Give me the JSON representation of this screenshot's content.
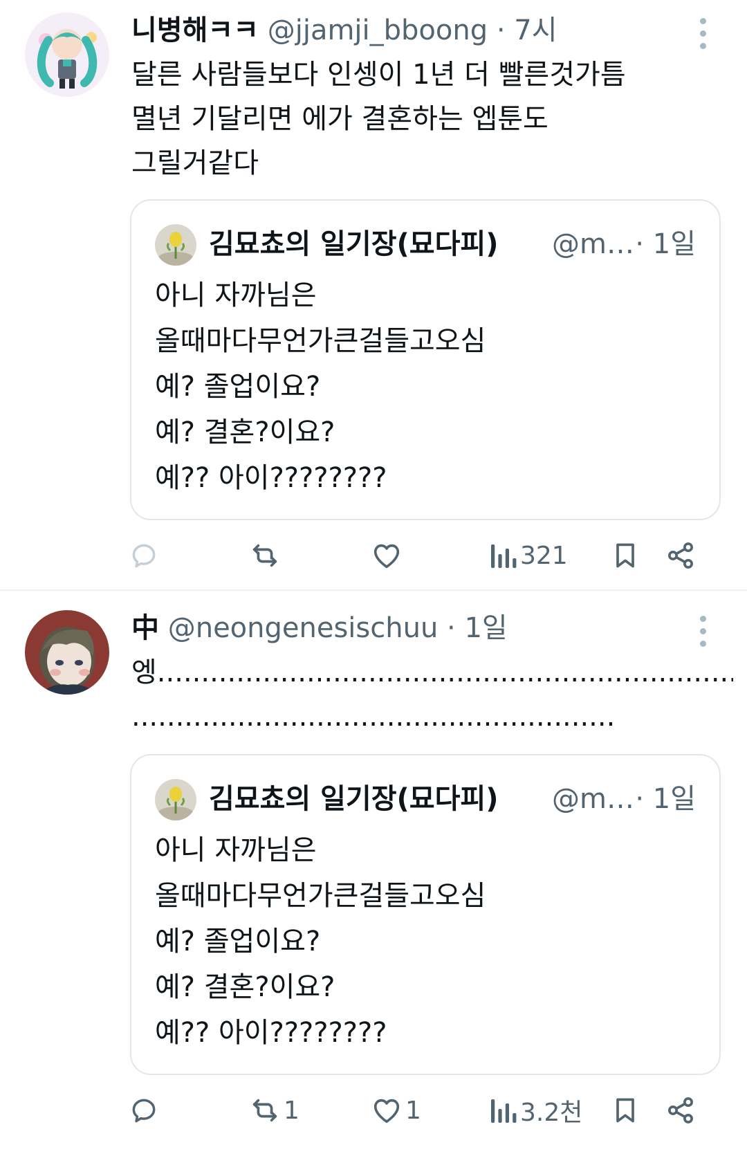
{
  "tweets": [
    {
      "display_name": "니병해ㅋㅋ",
      "handle": "@jjamji_bboong",
      "time": "7시",
      "text": "달른 사람들보다 인셍이 1년 더 빨른것가틈\n멸년 기달리면 에가 결혼하는 엡툰도\n그릴거같다",
      "quote": {
        "display_name": "김묘쵸의 일기장(묘다피)",
        "handle": "@m…",
        "time": "1일",
        "text": "아니 자까님은\n올때마다무언가큰걸들고오심\n예? 졸업이요?\n예? 결혼?이요?\n예?? 아이????????"
      },
      "stats": {
        "replies": "",
        "retweets": "",
        "likes": "",
        "views": "321"
      }
    },
    {
      "display_name": "中",
      "handle": "@neongenesischuu",
      "time": "1일",
      "text": "엥.....................................................................\n.......................................................",
      "quote": {
        "display_name": "김묘쵸의 일기장(묘다피)",
        "handle": "@m…",
        "time": "1일",
        "text": "아니 자까님은\n올때마다무언가큰걸들고오심\n예? 졸업이요?\n예? 결혼?이요?\n예?? 아이????????"
      },
      "stats": {
        "replies": "",
        "retweets": "1",
        "likes": "1",
        "views": "3.2천"
      }
    }
  ],
  "ui": {
    "separator": " · "
  },
  "icons": [
    "reply-icon",
    "retweet-icon",
    "like-icon",
    "views-icon",
    "bookmark-icon",
    "share-icon",
    "more-icon"
  ],
  "colors": {
    "text": "#0f1419",
    "secondary": "#536471",
    "border": "#e1e8ed",
    "background": "#ffffff"
  }
}
